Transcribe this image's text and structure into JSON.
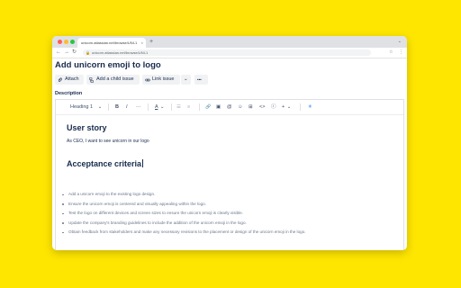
{
  "browser": {
    "tab_title": "unicorn.atlassian.net/browse/UNI-1",
    "tab_close": "×",
    "new_tab": "+",
    "address": "unicorn.atlassian.net/browse/UNI-1",
    "back_glyph": "←",
    "forward_glyph": "→",
    "reload_glyph": "↻",
    "lock_glyph": "🔒",
    "star_glyph": "☆",
    "menu_glyph": "⋮",
    "tab_menu_glyph": "⌄"
  },
  "issue": {
    "title": "Add unicorn emoji to logo",
    "actions": {
      "attach": "Attach",
      "child_issue": "Add a child issue",
      "link_issue": "Link issue",
      "dropdown": "⌄",
      "more": "•••"
    },
    "description_label": "Description"
  },
  "editor_toolbar": {
    "heading": "Heading 1",
    "heading_chevron": "⌄",
    "bold": "B",
    "italic": "I",
    "more_text": "···",
    "text_color": "A",
    "color_chevron": "⌄",
    "bullet_list": "☰",
    "numbered_list": "≡",
    "link": "🔗",
    "image": "▣",
    "mention": "@",
    "emoji": "☺",
    "table": "⊞",
    "code": "<>",
    "info": "ⓘ",
    "insert": "+",
    "insert_chevron": "⌄",
    "ai": "✳"
  },
  "description": {
    "heading_1": "User story",
    "paragraph_1": "As CEO, I want to see unicorn in our logo",
    "heading_2": "Acceptance criteria",
    "bullets": [
      "Add a unicorn emoji to the existing logo design.",
      "Ensure the unicorn emoji is centered and visually appealing within the logo.",
      "Test the logo on different devices and screen sizes to ensure the unicorn emoji is clearly visible.",
      "Update the company's branding guidelines to include the addition of the unicorn emoji in the logo.",
      "Obtain feedback from stakeholders and make any necessary revisions to the placement or design of the unicorn emoji in the logo."
    ]
  },
  "colors": {
    "background": "#ffe600",
    "text_primary": "#172b4d",
    "text_muted": "#6b778c",
    "button_bg": "#f1f2f4",
    "ai_accent": "#1d7afc"
  }
}
